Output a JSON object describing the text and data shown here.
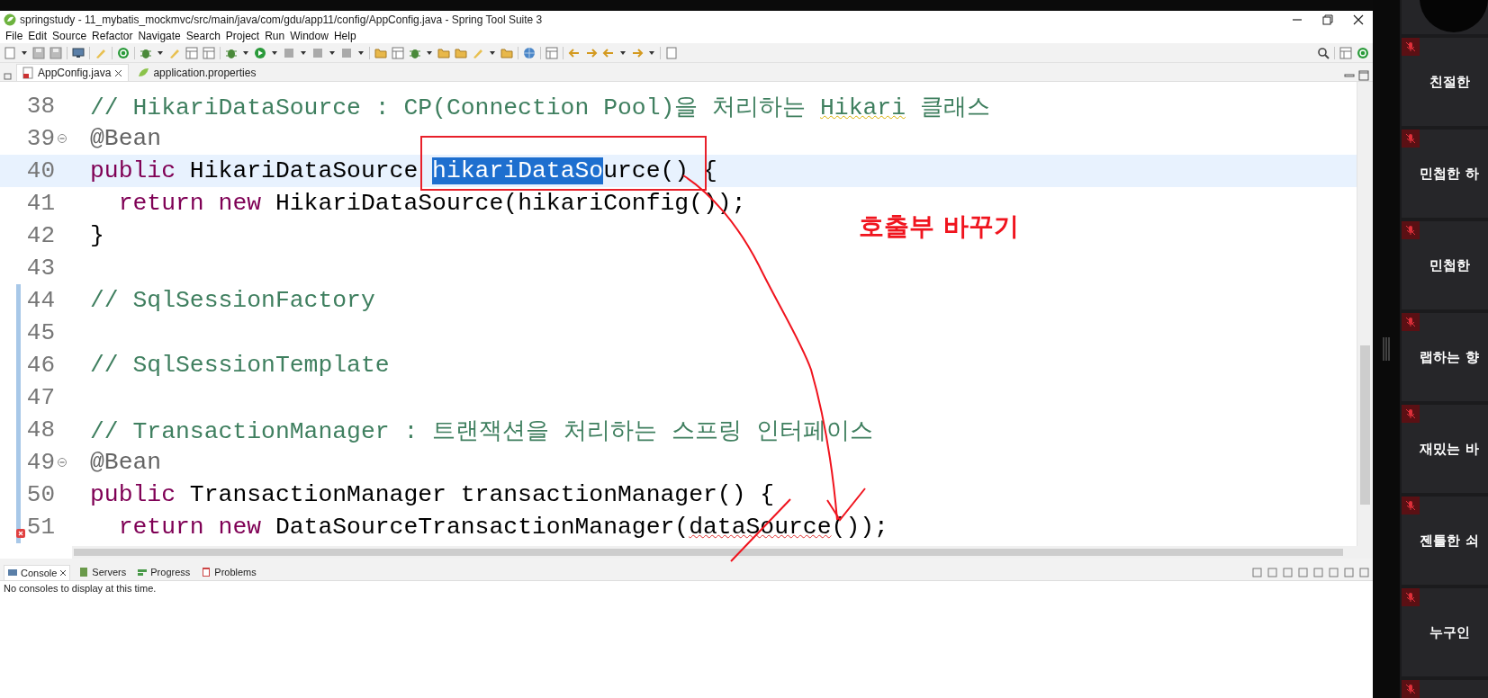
{
  "window": {
    "title": "springstudy - 11_mybatis_mockmvc/src/main/java/com/gdu/app11/config/AppConfig.java - Spring Tool Suite 3"
  },
  "menu": [
    "File",
    "Edit",
    "Source",
    "Refactor",
    "Navigate",
    "Search",
    "Project",
    "Run",
    "Window",
    "Help"
  ],
  "editor_tabs": [
    {
      "label": "AppConfig.java",
      "selected": true,
      "kind": "java"
    },
    {
      "label": "application.properties",
      "selected": false,
      "kind": "properties"
    }
  ],
  "code_lines": [
    {
      "number": "38",
      "fold": false,
      "changed": false,
      "current": false,
      "error": false,
      "segments": [
        {
          "kind": "comment",
          "text": "// HikariDataSource : CP(Connection Pool)을 처리하는 "
        },
        {
          "kind": "typo",
          "text": "Hikari"
        },
        {
          "kind": "comment",
          "text": " 클래스"
        }
      ]
    },
    {
      "number": "39",
      "fold": true,
      "changed": false,
      "current": false,
      "error": false,
      "segments": [
        {
          "kind": "annotation",
          "text": "@Bean"
        }
      ]
    },
    {
      "number": "40",
      "fold": false,
      "changed": false,
      "current": true,
      "error": false,
      "segments": [
        {
          "kind": "keyword",
          "text": "public"
        },
        {
          "kind": "plain",
          "text": " HikariDataSource "
        },
        {
          "kind": "selected",
          "text": "hikariDataSo"
        },
        {
          "kind": "plain",
          "text": "urce() {"
        }
      ]
    },
    {
      "number": "41",
      "fold": false,
      "changed": false,
      "current": false,
      "error": false,
      "indented": true,
      "segments": [
        {
          "kind": "keyword",
          "text": "return new"
        },
        {
          "kind": "plain",
          "text": " HikariDataSource(hikariConfig());"
        }
      ]
    },
    {
      "number": "42",
      "fold": false,
      "changed": false,
      "current": false,
      "error": false,
      "segments": [
        {
          "kind": "plain",
          "text": "}"
        }
      ]
    },
    {
      "number": "43",
      "fold": false,
      "changed": false,
      "current": false,
      "error": false
    },
    {
      "number": "44",
      "fold": false,
      "changed": true,
      "current": false,
      "error": false,
      "segments": [
        {
          "kind": "comment",
          "text": "// SqlSessionFactory"
        }
      ]
    },
    {
      "number": "45",
      "fold": false,
      "changed": true,
      "current": false,
      "error": false
    },
    {
      "number": "46",
      "fold": false,
      "changed": true,
      "current": false,
      "error": false,
      "segments": [
        {
          "kind": "comment",
          "text": "// SqlSessionTemplate"
        }
      ]
    },
    {
      "number": "47",
      "fold": false,
      "changed": true,
      "current": false,
      "error": false
    },
    {
      "number": "48",
      "fold": false,
      "changed": true,
      "current": false,
      "error": false,
      "segments": [
        {
          "kind": "comment",
          "text": "// TransactionManager : 트랜잭션을 처리하는 스프링 인터페이스"
        }
      ]
    },
    {
      "number": "49",
      "fold": true,
      "changed": true,
      "current": false,
      "error": false,
      "segments": [
        {
          "kind": "annotation",
          "text": "@Bean"
        }
      ]
    },
    {
      "number": "50",
      "fold": false,
      "changed": true,
      "current": false,
      "error": false,
      "segments": [
        {
          "kind": "keyword",
          "text": "public"
        },
        {
          "kind": "plain",
          "text": " TransactionManager transactionManager() {"
        }
      ]
    },
    {
      "number": "51",
      "fold": false,
      "changed": true,
      "current": false,
      "error": true,
      "indented": true,
      "segments": [
        {
          "kind": "keyword",
          "text": "return new"
        },
        {
          "kind": "plain",
          "text": " DataSourceTransactionManager("
        },
        {
          "kind": "error",
          "text": "dataSource"
        },
        {
          "kind": "plain",
          "text": "());"
        }
      ]
    }
  ],
  "annotation": {
    "note": "호출부 바꾸기"
  },
  "bottom_tabs": [
    {
      "label": "Console",
      "selected": true,
      "kind": "console"
    },
    {
      "label": "Servers",
      "selected": false,
      "kind": "servers"
    },
    {
      "label": "Progress",
      "selected": false,
      "kind": "progress"
    },
    {
      "label": "Problems",
      "selected": false,
      "kind": "problems"
    }
  ],
  "console": {
    "message": "No consoles to display at this time."
  },
  "participants": [
    {
      "name": "친절한",
      "muted": true
    },
    {
      "name": "민첩한 하",
      "muted": true
    },
    {
      "name": "민첩한",
      "muted": true
    },
    {
      "name": "랩하는 향",
      "muted": true
    },
    {
      "name": "재밌는 바",
      "muted": true
    },
    {
      "name": "젠틀한 쇠",
      "muted": true
    },
    {
      "name": "누구인",
      "muted": true
    },
    {
      "muted": true
    }
  ]
}
